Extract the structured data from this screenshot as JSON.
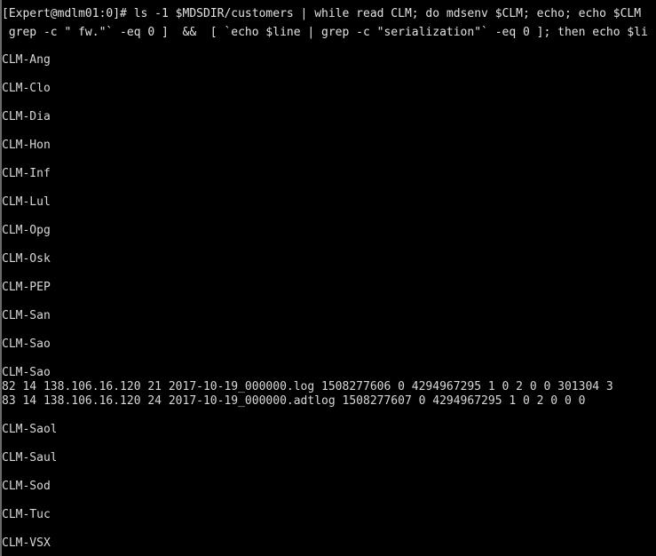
{
  "terminal": {
    "title": "Terminal",
    "background_color": "#000000",
    "foreground_color": "#d8d8d8",
    "edge_color": "#6a6a6a",
    "prompt": "[Expert@mdlm01:0]#",
    "command_lines": [
      "[Expert@mdlm01:0]# ls -1 $MDSDIR/customers | while read CLM; do mdsenv $CLM; echo; echo $CLM",
      " grep -c \" fw.\"` -eq 0 ]  &&  [ `echo $line | grep -c \"serialization\"` -eq 0 ]; then echo $li"
    ],
    "customers_top": [
      "CLM-Ang",
      "CLM-Clo",
      "CLM-Dia",
      "CLM-Hon",
      "CLM-Inf",
      "CLM-Lul",
      "CLM-Opg",
      "CLM-Osk",
      "CLM-PEP",
      "CLM-San",
      "CLM-Sao",
      "CLM-Sao"
    ],
    "log_rows": [
      "82 14 138.106.16.120 21 2017-10-19_000000.log 1508277606 0 4294967295 1 0 2 0 0 301304 3",
      "83 14 138.106.16.120 24 2017-10-19_000000.adtlog 1508277607 0 4294967295 1 0 2 0 0 0"
    ],
    "customers_bottom": [
      "CLM-Saol",
      "CLM-Saul",
      "CLM-Sod",
      "CLM-Tuc",
      "CLM-VSX"
    ]
  }
}
